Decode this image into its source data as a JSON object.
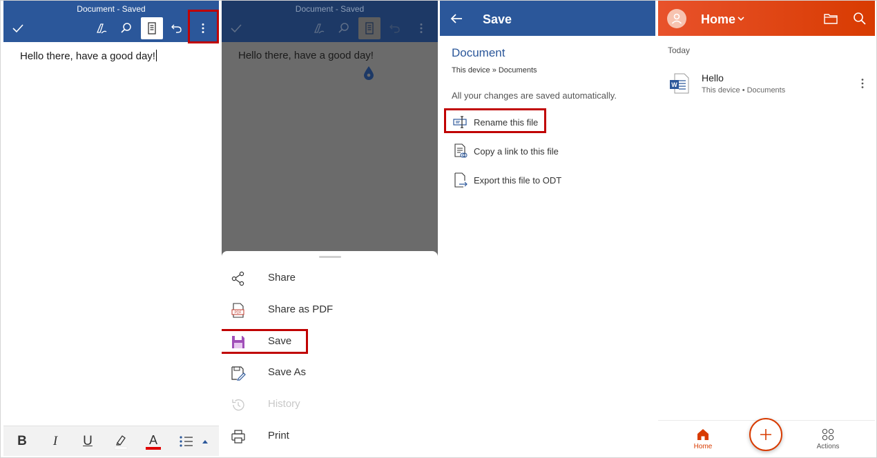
{
  "colors": {
    "word_blue": "#2b579a",
    "office_orange": "#d83b01",
    "highlight_red": "#c00000"
  },
  "panel1": {
    "title": "Document - Saved",
    "toolbar": {
      "check_icon": "check-icon",
      "draw_icon": "draw-pen-icon",
      "search_icon": "search-icon",
      "view_icon": "reading-view-icon",
      "undo_icon": "undo-icon",
      "more_icon": "more-vertical-icon"
    },
    "body_text": "Hello there, have a good day!",
    "format_bar": {
      "bold": "B",
      "italic": "I",
      "underline": "U",
      "font_color": "A"
    }
  },
  "panel2": {
    "title": "Document - Saved",
    "body_text": "Hello there, have a good day!",
    "menu": [
      {
        "label": "Share",
        "icon": "share-icon"
      },
      {
        "label": "Share as PDF",
        "icon": "pdf-icon"
      },
      {
        "label": "Save",
        "icon": "save-icon"
      },
      {
        "label": "Save As",
        "icon": "save-as-icon"
      },
      {
        "label": "History",
        "icon": "history-icon",
        "disabled": true
      },
      {
        "label": "Print",
        "icon": "print-icon"
      }
    ]
  },
  "panel3": {
    "header_title": "Save",
    "doc_name": "Document",
    "doc_location": "This device » Documents",
    "auto_save_note": "All your changes are saved automatically.",
    "actions": [
      {
        "label": "Rename this file",
        "icon": "rename-icon"
      },
      {
        "label": "Copy a link to this file",
        "icon": "copy-link-icon"
      },
      {
        "label": "Export this file to ODT",
        "icon": "export-icon"
      }
    ]
  },
  "panel4": {
    "header_title": "Home",
    "section": "Today",
    "file": {
      "name": "Hello",
      "location": "This device • Documents",
      "icon": "word-file-icon"
    },
    "nav": {
      "home_label": "Home",
      "actions_label": "Actions",
      "fab_icon": "plus-icon"
    }
  }
}
